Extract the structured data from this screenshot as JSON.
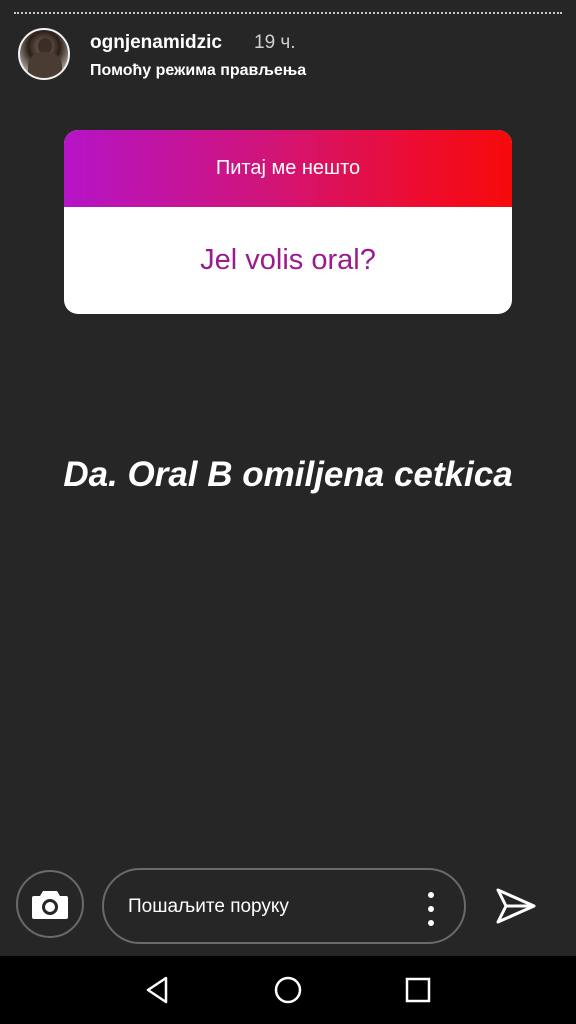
{
  "story": {
    "username": "ognjenamidzic",
    "time": "19 ч.",
    "subtitle": "Помоћу режима прављења"
  },
  "question_sticker": {
    "header": "Питај ме нешто",
    "question": "Jel volis oral?"
  },
  "answer_text": "Da. Oral B omiljena cetkica",
  "reply_bar": {
    "placeholder": "Пошаљите поруку"
  },
  "icons": {
    "camera": "camera-icon",
    "more": "more-vertical-icon",
    "send": "send-icon",
    "back": "nav-back-icon",
    "home": "nav-home-icon",
    "recents": "nav-recents-icon"
  },
  "colors": {
    "background": "#262626",
    "gradient_start": "#b514c7",
    "gradient_end": "#f50a0a",
    "question_text": "#9b1b8e"
  }
}
